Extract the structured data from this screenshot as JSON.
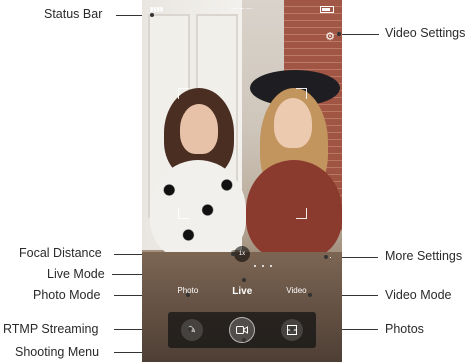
{
  "labels": {
    "status_bar": "Status Bar",
    "video_settings": "Video Settings",
    "focal_distance": "Focal Distance",
    "more_settings": "More Settings",
    "live_mode": "Live Mode",
    "photo_mode": "Photo Mode",
    "video_mode": "Video Mode",
    "rtmp_streaming": "RTMP Streaming",
    "photos": "Photos",
    "shooting_menu": "Shooting Menu"
  },
  "screen": {
    "focal_value": "1x",
    "modes": {
      "photo": "Photo",
      "live": "Live",
      "video": "Video"
    }
  },
  "icons": {
    "video_settings": "gear-icon",
    "more_settings": "more-dots-icon",
    "rtmp": "pencil-stream-icon",
    "shutter": "video-camera-icon",
    "photos": "gallery-icon"
  },
  "colors": {
    "annotation_line": "#333333",
    "label_text": "#2a2a2a",
    "menu_bg": "#141414"
  }
}
